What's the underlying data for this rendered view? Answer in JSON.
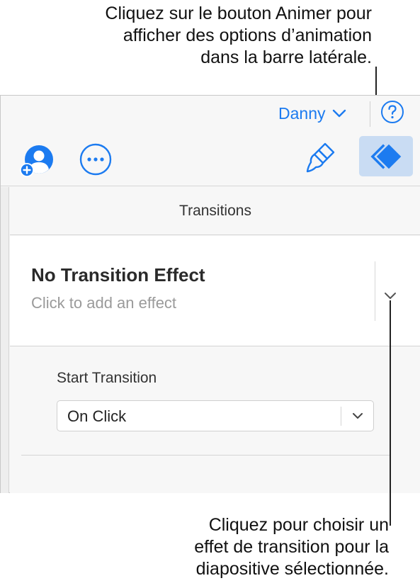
{
  "callouts": {
    "top": {
      "line1": "Cliquez sur le bouton Animer pour",
      "line2": "afficher des options d’animation",
      "line3": "dans la barre latérale."
    },
    "bottom": {
      "line1": "Cliquez pour choisir un",
      "line2": "effet de transition pour la",
      "line3": "diapositive sélectionnée."
    }
  },
  "toolbar": {
    "user_name": "Danny",
    "help_icon": "question-circle-icon",
    "collaborate_icon": "add-person-icon",
    "more_icon": "ellipsis-circle-icon",
    "format_icon": "paintbrush-icon",
    "animate_icon": "animate-diamond-icon"
  },
  "sidebar": {
    "title": "Transitions",
    "effect": {
      "title": "No Transition Effect",
      "subtitle": "Click to add an effect"
    },
    "start_transition": {
      "label": "Start Transition",
      "value": "On Click"
    }
  },
  "colors": {
    "accent": "#1c7bf0",
    "selected_button_bg": "#c9dcf3",
    "panel_bg": "#f7f7f7"
  }
}
